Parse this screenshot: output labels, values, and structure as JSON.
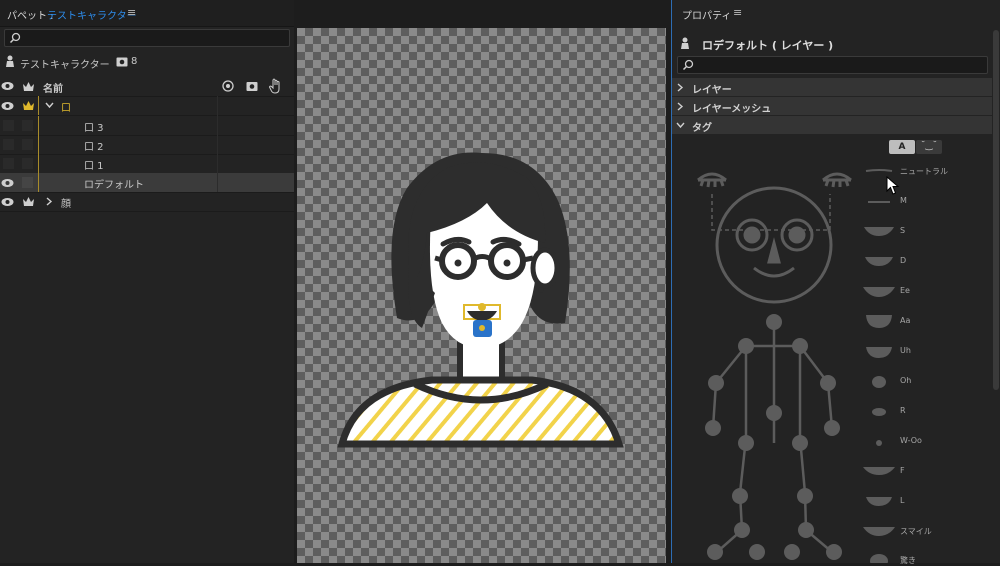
{
  "puppet_panel": {
    "title": "パペット :",
    "puppet_name": "テストキャラクター",
    "menu_icon": "≡",
    "search_placeholder": "",
    "puppet_label": "テストキャラクター",
    "count": "8",
    "column_name": "名前",
    "rows": [
      {
        "label": "口",
        "expanded": true
      },
      {
        "label": "口 3"
      },
      {
        "label": "口 2"
      },
      {
        "label": "口 1"
      },
      {
        "label": "ロデフォルト"
      },
      {
        "label": "顔",
        "expanded": false
      }
    ]
  },
  "properties_panel": {
    "title": "プロパティ",
    "menu_icon": "≡",
    "layer_name": "ロデフォルト ( レイヤー )",
    "sections": [
      "レイヤー",
      "レイヤーメッシュ",
      "タグ"
    ],
    "tag_toggle": {
      "a_label": "A",
      "face_label": "˘‿˘"
    },
    "mouth_tags": [
      "ニュートラル",
      "M",
      "S",
      "D",
      "Ee",
      "Aa",
      "Uh",
      "Oh",
      "R",
      "W-Oo",
      "F",
      "L",
      "スマイル",
      "驚き"
    ]
  },
  "colors": {
    "accent": "#2d8ceb",
    "crown": "#e0b92c",
    "panel": "#232323",
    "stripe": "#f2d34a"
  }
}
